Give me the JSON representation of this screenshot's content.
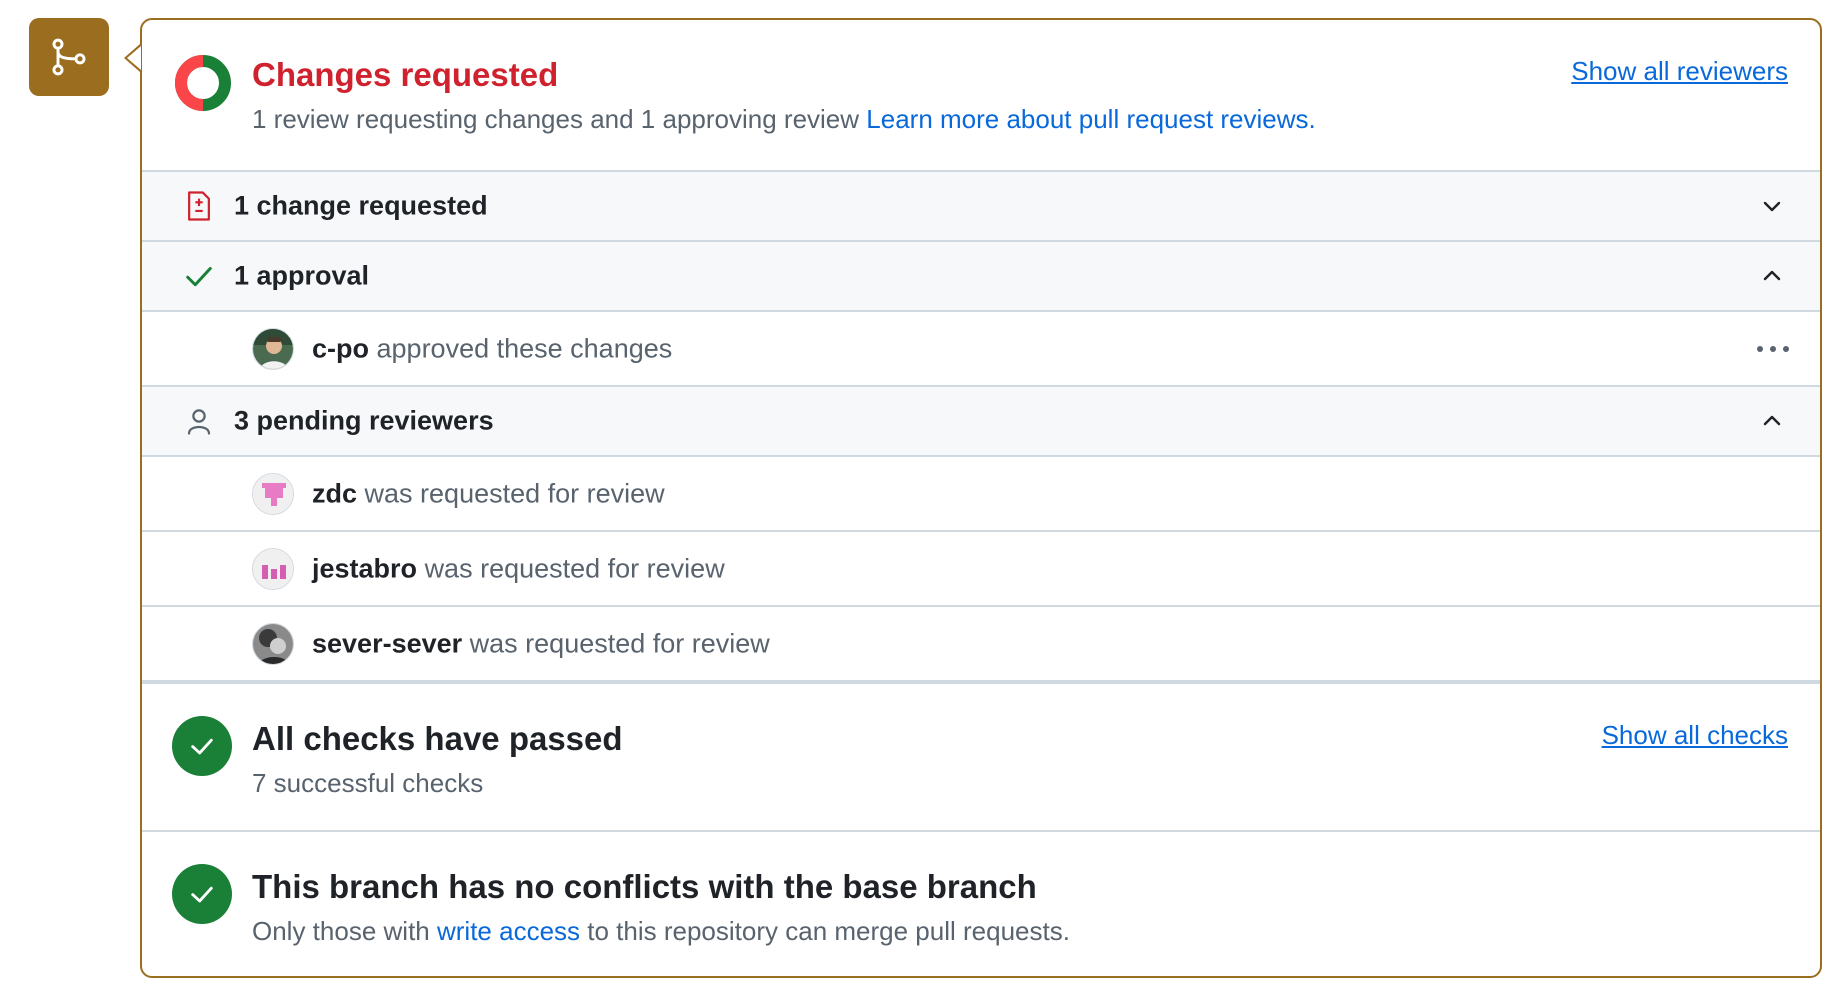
{
  "colors": {
    "accent_gold": "#9a6d1f",
    "danger": "#cf222e",
    "success": "#1a7f37",
    "link": "#0969da"
  },
  "review_status": {
    "title": "Changes requested",
    "subtitle": "1 review requesting changes and 1 approving review",
    "learn_more_link": "Learn more about pull request reviews.",
    "show_all_reviewers": "Show all reviewers",
    "ring_icon": "review-status-ring-icon"
  },
  "groups": {
    "changes": {
      "label": "1 change requested",
      "icon": "file-diff-icon",
      "expanded": false
    },
    "approvals": {
      "label": "1 approval",
      "icon": "check-icon",
      "expanded": true,
      "items": [
        {
          "user": "c-po",
          "action": "approved these changes"
        }
      ]
    },
    "pending": {
      "label": "3 pending reviewers",
      "icon": "person-icon",
      "expanded": true,
      "items": [
        {
          "user": "zdc",
          "action": "was requested for review"
        },
        {
          "user": "jestabro",
          "action": "was requested for review"
        },
        {
          "user": "sever-sever",
          "action": "was requested for review"
        }
      ]
    }
  },
  "checks": {
    "title": "All checks have passed",
    "subtitle": "7 successful checks",
    "show_all_checks": "Show all checks"
  },
  "conflicts": {
    "title": "This branch has no conflicts with the base branch",
    "subtitle_before": "Only those with",
    "link": "write access",
    "subtitle_after": "to this repository can merge pull requests."
  }
}
